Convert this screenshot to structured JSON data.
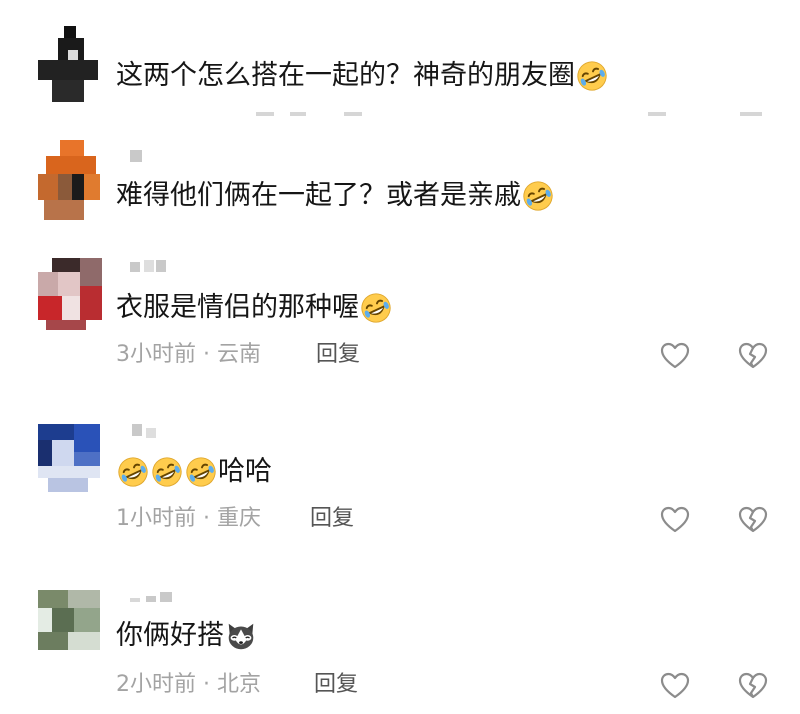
{
  "comments": [
    {
      "text": "这两个怎么搭在一起的？神奇的朋友圈",
      "emoji": "rofl-emoji"
    },
    {
      "text": "难得他们俩在一起了？或者是亲戚",
      "emoji": "rofl-emoji"
    },
    {
      "text": "衣服是情侣的那种喔",
      "emoji": "rofl-emoji",
      "time": "3小时前",
      "location": "云南",
      "reply": "回复"
    },
    {
      "text": "哈哈",
      "emoji": "rofl-emoji",
      "time": "1小时前",
      "location": "重庆",
      "reply": "回复"
    },
    {
      "text": "你俩好搭",
      "emoji": "husky-emoji",
      "time": "2小时前",
      "location": "北京",
      "reply": "回复"
    }
  ],
  "meta_separator": " · ",
  "icons": {
    "like": "heart-outline-icon",
    "dislike": "broken-heart-icon"
  },
  "colors": {
    "text": "#161616",
    "meta": "#a3a3a3",
    "reply": "#555555",
    "icon": "#8c8c8c"
  }
}
